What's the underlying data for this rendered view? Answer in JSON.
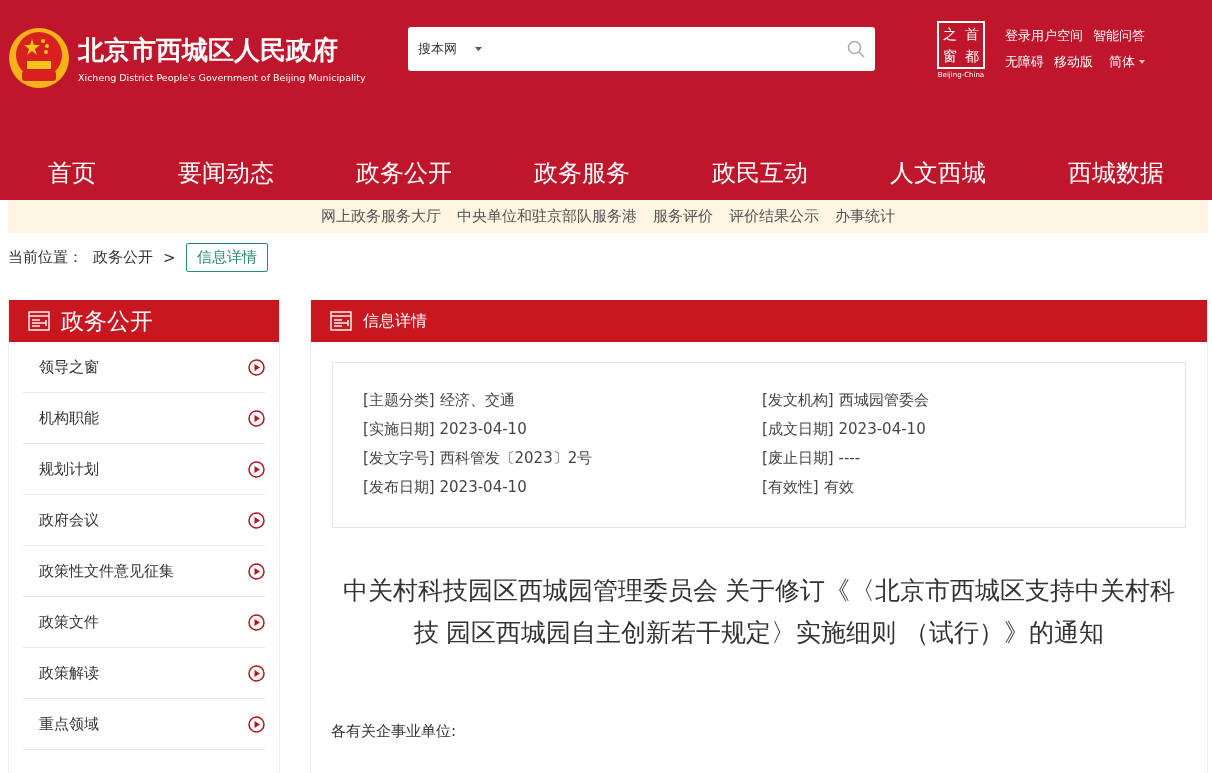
{
  "header": {
    "title": "北京市西城区人民政府",
    "subtitle": "Xicheng District People's Government of Beijing Municipality",
    "search": {
      "scope": "搜本网"
    },
    "badge": {
      "chars": [
        "之",
        "首",
        "窗",
        "都"
      ],
      "caption": "Beijing-China"
    },
    "links_top": [
      "登录用户空间",
      "智能问答"
    ],
    "links_bottom": [
      "无障碍",
      "移动版"
    ],
    "language": "简体"
  },
  "nav": [
    {
      "label": "首页"
    },
    {
      "label": "要闻动态"
    },
    {
      "label": "政务公开"
    },
    {
      "label": "政务服务"
    },
    {
      "label": "政民互动"
    },
    {
      "label": "人文西城"
    },
    {
      "label": "西城数据"
    }
  ],
  "subnav": [
    "网上政务服务大厅",
    "中央单位和驻京部队服务港",
    "服务评价",
    "评价结果公示",
    "办事统计"
  ],
  "breadcrumb": {
    "label": "当前位置：",
    "parent": "政务公开",
    "separator": ">",
    "current": "信息详情"
  },
  "sidebar": {
    "title": "政务公开",
    "items": [
      "领导之窗",
      "机构职能",
      "规划计划",
      "政府会议",
      "政策性文件意见征集",
      "政策文件",
      "政策解读",
      "重点领域"
    ]
  },
  "detail": {
    "title": "信息详情",
    "meta": [
      {
        "key": "[主题分类]",
        "value": "经济、交通"
      },
      {
        "key": "[发文机构]",
        "value": "西城园管委会"
      },
      {
        "key": "[实施日期]",
        "value": "2023-04-10"
      },
      {
        "key": "[成文日期]",
        "value": "2023-04-10"
      },
      {
        "key": "[发文字号]",
        "value": "西科管发〔2023〕2号"
      },
      {
        "key": "[废止日期]",
        "value": "----"
      },
      {
        "key": "[发布日期]",
        "value": "2023-04-10"
      },
      {
        "key": "[有效性]",
        "value": "有效"
      }
    ],
    "heading": "中关村科技园区西城园管理委员会 关于修订《〈北京市西城区支持中关村科技 园区西城园自主创新若干规定〉实施细则 （试行）》的通知",
    "salutation": "各有关企事业单位:"
  }
}
